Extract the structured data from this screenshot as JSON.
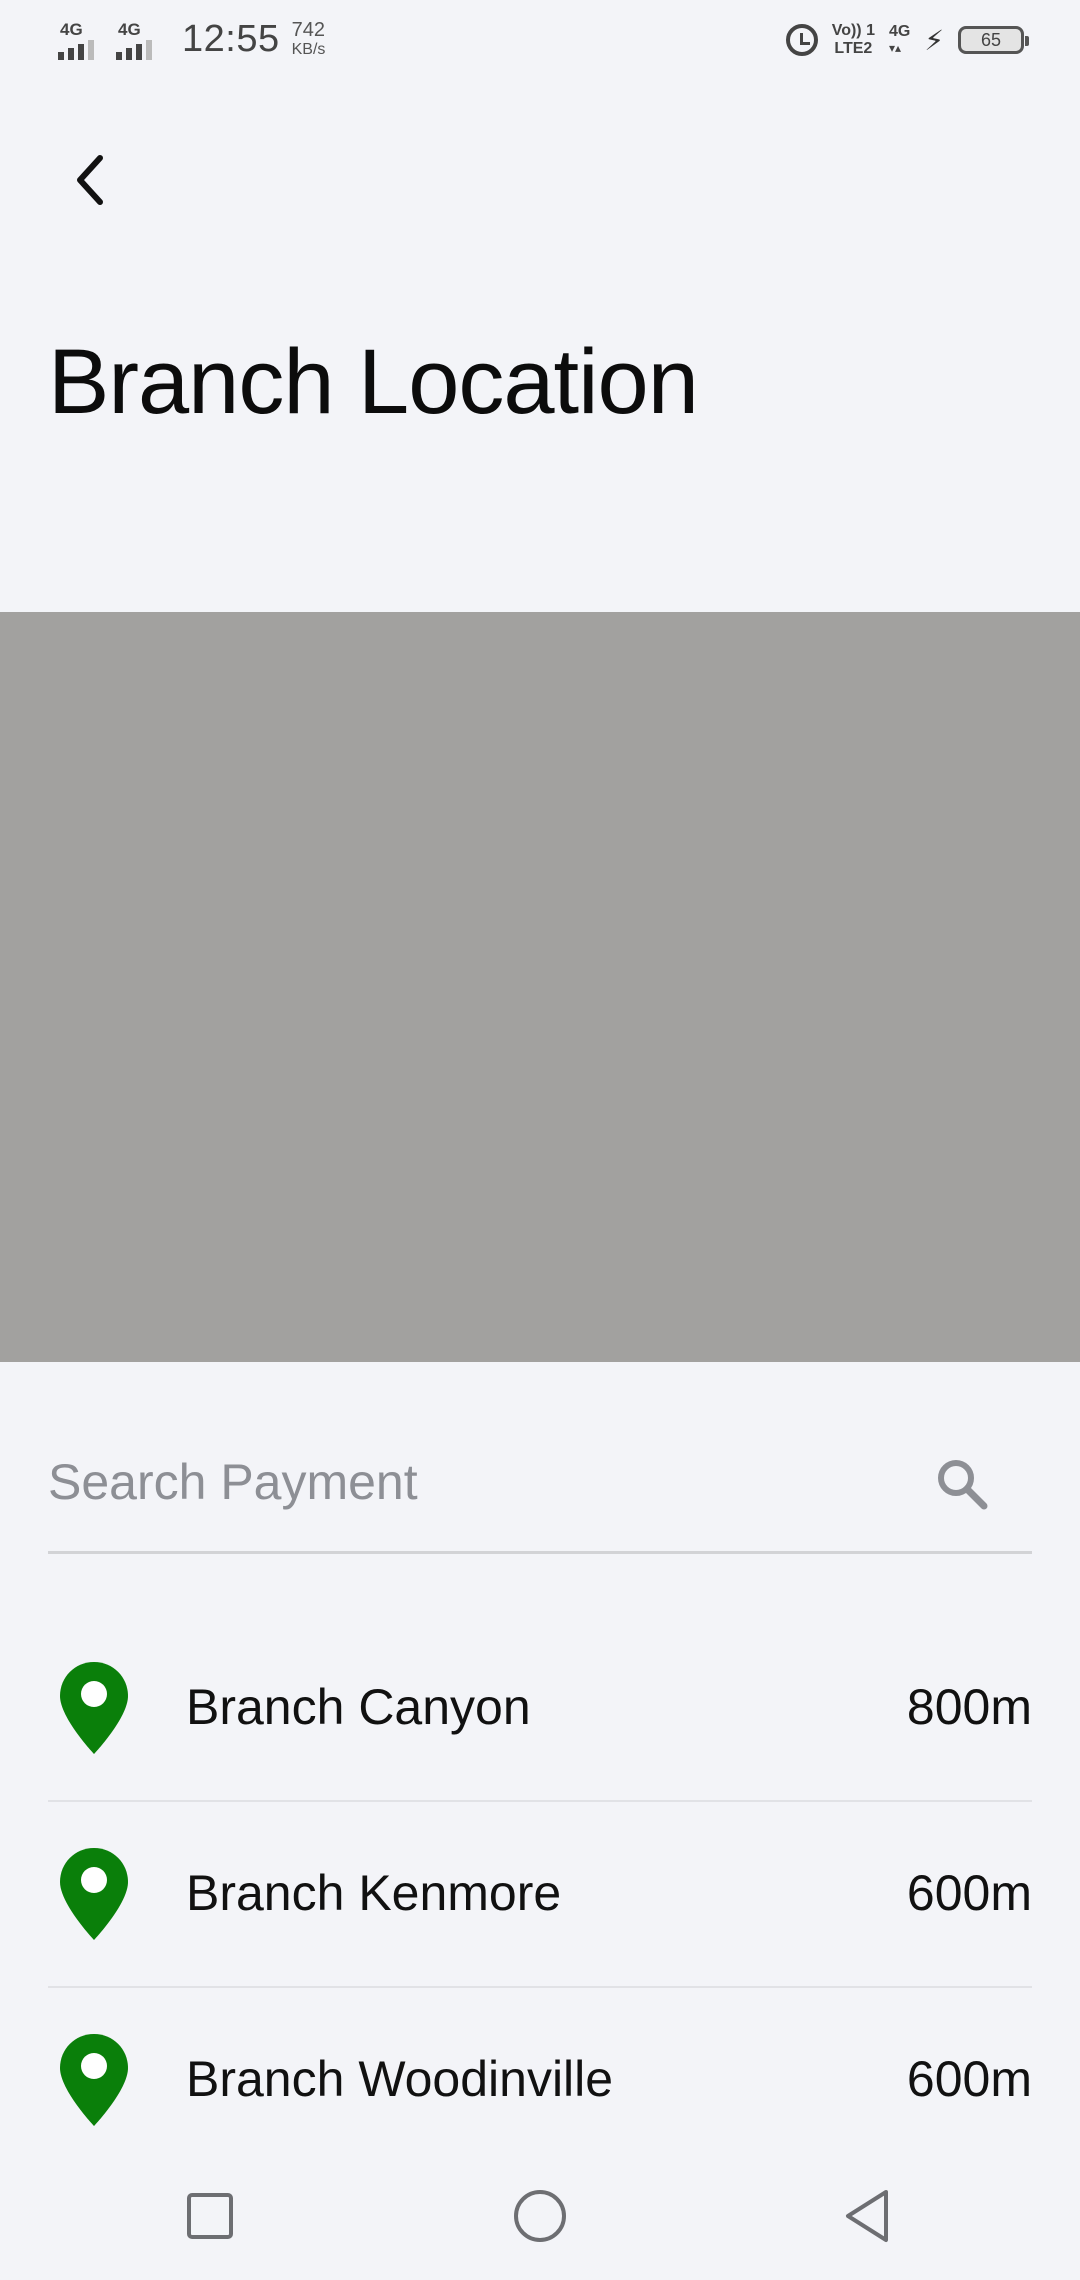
{
  "status_bar": {
    "signal1_label": "4G",
    "signal2_label": "4G",
    "time": "12:55",
    "speed_value": "742",
    "speed_unit": "KB/s",
    "volte_line1": "Vo)) 1",
    "volte_line2": "LTE2",
    "net_label": "4G",
    "battery_level": "65"
  },
  "header": {
    "back_icon": "chevron-left-icon",
    "title": "Branch Location"
  },
  "map": {
    "placeholder_color": "#a2a19f"
  },
  "search": {
    "placeholder": "Search Payment",
    "value": "",
    "icon": "search-icon"
  },
  "branches": [
    {
      "name": "Branch Canyon",
      "distance": "800m",
      "icon": "location-pin-icon"
    },
    {
      "name": "Branch Kenmore",
      "distance": "600m",
      "icon": "location-pin-icon"
    },
    {
      "name": "Branch Woodinville",
      "distance": "600m",
      "icon": "location-pin-icon"
    }
  ],
  "colors": {
    "background": "#f3f4f8",
    "pin": "#0a7f0a",
    "map_gray": "#a2a19f",
    "divider": "#e1e2e6"
  },
  "nav_bar": {
    "items": [
      "recents-square-icon",
      "home-circle-icon",
      "back-triangle-icon"
    ]
  }
}
